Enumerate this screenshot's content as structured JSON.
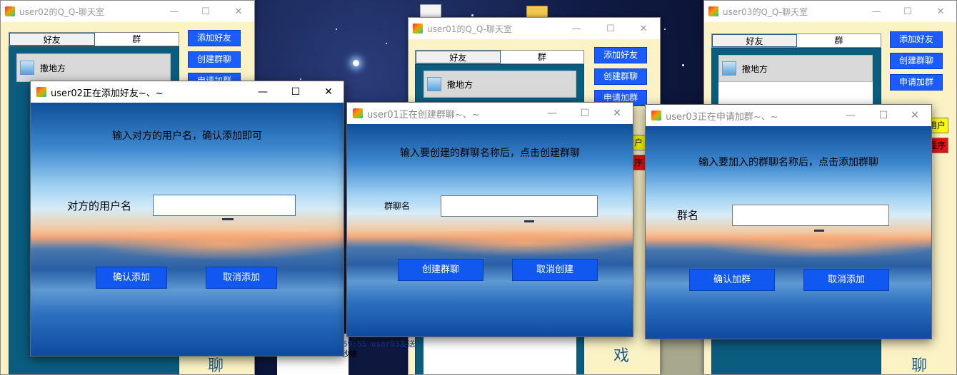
{
  "bg_windows": {
    "w1": {
      "title": "user02的Q_Q-聊天室",
      "tabs": [
        "好友",
        "群"
      ],
      "friend": "撒地方",
      "buttons": [
        "添加好友",
        "创建群聊",
        "申请加群"
      ],
      "big_text": "聊"
    },
    "w2": {
      "title": "user01的Q_Q-聊天室",
      "tabs": [
        "好友",
        "群"
      ],
      "friend": "撒地方",
      "buttons": [
        "添加好友",
        "创建群聊",
        "申请加群"
      ],
      "side_yellow": "用户",
      "side_red": "程序",
      "big_text": "戏",
      "chat_line1": "5",
      "chat_line2": "59:55 user03发送",
      "chat_line3": "秒啥"
    },
    "w3": {
      "title": "user03的Q_Q-聊天室",
      "tabs": [
        "好友",
        "群"
      ],
      "friend": "撒地方",
      "buttons": [
        "添加好友",
        "创建群聊",
        "申请加群"
      ],
      "side_yellow": "用户",
      "side_red": "程序",
      "big_text": "聊"
    }
  },
  "dialogs": {
    "add_friend": {
      "title": "user02正在添加好友~、~",
      "prompt": "输入对方的用户名，确认添加即可",
      "label": "对方的用户名",
      "input_value": "",
      "confirm": "确认添加",
      "cancel": "取消添加"
    },
    "create_group": {
      "title": "user01正在创建群聊~、~",
      "prompt": "输入要创建的群聊名称后，点击创建群聊",
      "label": "群聊名",
      "input_value": "",
      "confirm": "创建群聊",
      "cancel": "取消创建"
    },
    "join_group": {
      "title": "user03正在申请加群~、~",
      "prompt": "输入要加入的群聊名称后，点击添加群聊",
      "label": "群名",
      "input_value": "",
      "confirm": "确认加群",
      "cancel": "取消添加"
    }
  },
  "window_controls": {
    "minimize": "—",
    "maximize": "☐",
    "close": "✕"
  },
  "colors": {
    "accent_blue": "#1058f0",
    "panel_teal": "#0b5d80",
    "cream": "#fbf3c6"
  }
}
